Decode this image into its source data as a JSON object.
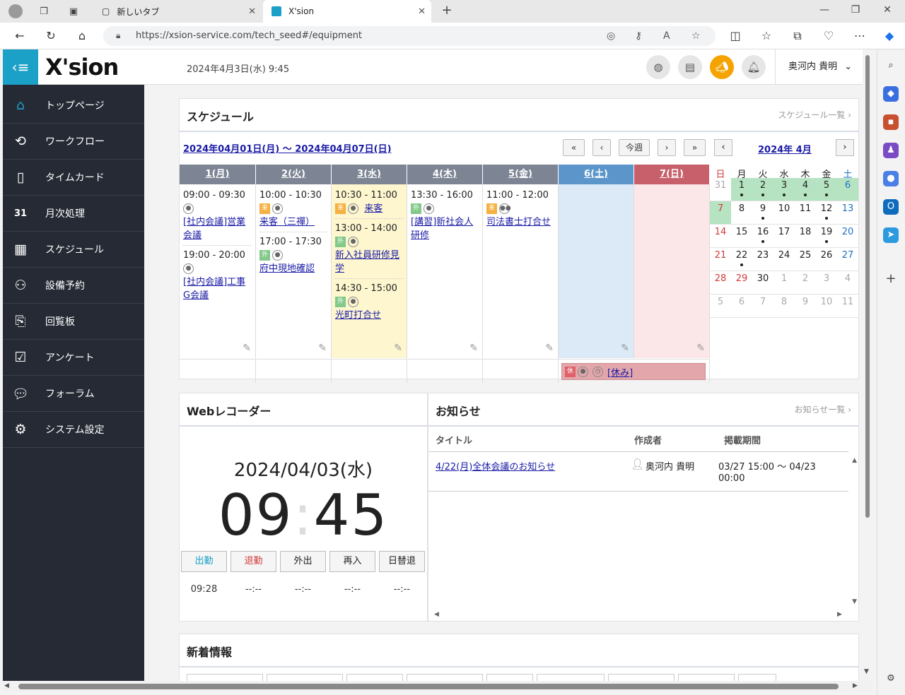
{
  "browser": {
    "tabs": [
      {
        "label": "新しいタブ"
      },
      {
        "label": "X'sion"
      }
    ],
    "url": "https://xsion-service.com/tech_seed#/equipment"
  },
  "header": {
    "logo_text": "X'sion",
    "datetime": "2024年4月3日(水) 9:45",
    "username": "奥河内 貴明"
  },
  "nav": {
    "items": [
      {
        "label": "トップページ",
        "icon": "home-icon"
      },
      {
        "label": "ワークフロー",
        "icon": "workflow-icon"
      },
      {
        "label": "タイムカード",
        "icon": "timecard-icon"
      },
      {
        "label": "月次処理",
        "icon": "calendar-31-icon"
      },
      {
        "label": "スケジュール",
        "icon": "schedule-icon"
      },
      {
        "label": "設備予約",
        "icon": "equipment-icon"
      },
      {
        "label": "回覧板",
        "icon": "clipboard-icon"
      },
      {
        "label": "アンケート",
        "icon": "survey-icon"
      },
      {
        "label": "フォーラム",
        "icon": "forum-icon"
      },
      {
        "label": "システム設定",
        "icon": "gear-icon"
      }
    ]
  },
  "schedule": {
    "title": "スケジュール",
    "list_link": "スケジュール一覧",
    "range": "2024年04月01日(月) ～ 2024年04月07日(日)",
    "this_week": "今週",
    "days": [
      {
        "label": "1(月)"
      },
      {
        "label": "2(火)"
      },
      {
        "label": "3(水)"
      },
      {
        "label": "4(木)"
      },
      {
        "label": "5(金)"
      },
      {
        "label": "6(土)"
      },
      {
        "label": "7(日)"
      }
    ],
    "events": {
      "mon": [
        {
          "time": "09:00 - 09:30",
          "title": "[社内会議]営業会議"
        },
        {
          "time": "19:00 - 20:00",
          "title": "[社内会議]工事G会議"
        }
      ],
      "tue": [
        {
          "time": "10:00 - 10:30",
          "tag": "来",
          "title": "来客（三禪）"
        },
        {
          "time": "17:00 - 17:30",
          "tag": "外",
          "title": "府中現地確認"
        }
      ],
      "wed": [
        {
          "time": "10:30 - 11:00",
          "tag": "来",
          "title": "来客"
        },
        {
          "time": "13:00 - 14:00",
          "tag": "外",
          "title": "新入社員研修見学"
        },
        {
          "time": "14:30 - 15:00",
          "tag": "外",
          "title": "光町打合せ"
        }
      ],
      "thu": [
        {
          "time": "13:30 - 16:00",
          "tag": "外",
          "title": "[講習]新社会人研修"
        }
      ],
      "fri": [
        {
          "time": "11:00 - 12:00",
          "tag": "来",
          "title": "司法書士打合せ"
        }
      ]
    },
    "holiday": {
      "tag": "休",
      "label": "[休み]"
    }
  },
  "minical": {
    "title": "2024年 4月",
    "dow": [
      "日",
      "月",
      "火",
      "水",
      "木",
      "金",
      "土"
    ],
    "weeks": [
      [
        "31",
        "1",
        "2",
        "3",
        "4",
        "5",
        "6"
      ],
      [
        "7",
        "8",
        "9",
        "10",
        "11",
        "12",
        "13"
      ],
      [
        "14",
        "15",
        "16",
        "17",
        "18",
        "19",
        "20"
      ],
      [
        "21",
        "22",
        "23",
        "24",
        "25",
        "26",
        "27"
      ],
      [
        "28",
        "29",
        "30",
        "1",
        "2",
        "3",
        "4"
      ],
      [
        "5",
        "6",
        "7",
        "8",
        "9",
        "10",
        "11"
      ]
    ]
  },
  "recorder": {
    "title": "Webレコーダー",
    "date": "2024/04/03(水)",
    "hour": "09",
    "minute": "45",
    "buttons": [
      {
        "label": "出勤",
        "value": "09:28"
      },
      {
        "label": "退勤",
        "value": "--:--"
      },
      {
        "label": "外出",
        "value": "--:--"
      },
      {
        "label": "再入",
        "value": "--:--"
      },
      {
        "label": "日替退",
        "value": "--:--"
      }
    ]
  },
  "notice": {
    "title": "お知らせ",
    "list_link": "お知らせ一覧",
    "col_title": "タイトル",
    "col_author": "作成者",
    "col_period": "掲載期間",
    "rows": [
      {
        "title": "4/22(月)全体会議のお知らせ",
        "author": "奥河内 貴明",
        "period_1": "03/27 15:00 ～ 04/23",
        "period_2": "00:00"
      }
    ]
  },
  "news": {
    "title": "新着情報"
  },
  "colors": {
    "accent": "#1ba0c8",
    "nav_bg": "#252a34",
    "weekday_head": "#7d8594",
    "sat_head": "#5b95c9",
    "sun_head": "#c7606a"
  }
}
